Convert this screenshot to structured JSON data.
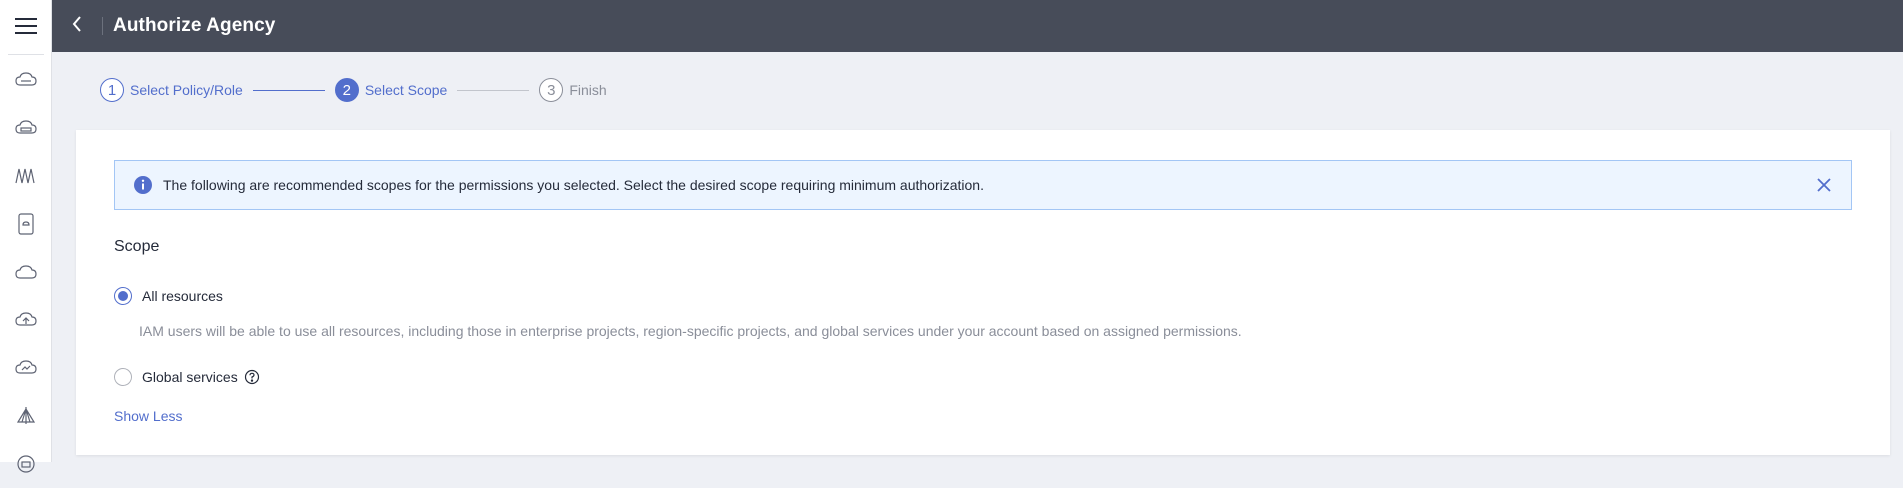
{
  "header": {
    "title": "Authorize Agency",
    "back_icon": "chevron-left-icon"
  },
  "rail": {
    "menu_icon": "hamburger-icon",
    "items": [
      {
        "icon": "cloud-server-icon"
      },
      {
        "icon": "cloud-storage-icon"
      },
      {
        "icon": "network-icon"
      },
      {
        "icon": "database-icon"
      },
      {
        "icon": "cloud-icon"
      },
      {
        "icon": "cloud-upload-icon"
      },
      {
        "icon": "cloud-monitor-icon"
      },
      {
        "icon": "tent-icon"
      },
      {
        "icon": "id-icon"
      }
    ]
  },
  "steps": [
    {
      "num": "1",
      "label": "Select Policy/Role",
      "state": "done"
    },
    {
      "num": "2",
      "label": "Select Scope",
      "state": "active"
    },
    {
      "num": "3",
      "label": "Finish",
      "state": "todo"
    }
  ],
  "alert": {
    "icon": "info-icon",
    "text": "The following are recommended scopes for the permissions you selected. Select the desired scope requiring minimum authorization.",
    "close_icon": "close-icon"
  },
  "scope": {
    "title": "Scope",
    "options": [
      {
        "label": "All resources",
        "checked": true,
        "description": "IAM users will be able to use all resources, including those in enterprise projects, region-specific projects, and global services under your account based on assigned permissions."
      },
      {
        "label": "Global services",
        "checked": false,
        "help_icon": "question-circle-icon"
      }
    ],
    "toggle_label": "Show Less"
  },
  "colors": {
    "topbar": "#474c59",
    "accent": "#526ecc",
    "alert_bg": "#edf5ff",
    "page_bg": "#eef0f5"
  }
}
